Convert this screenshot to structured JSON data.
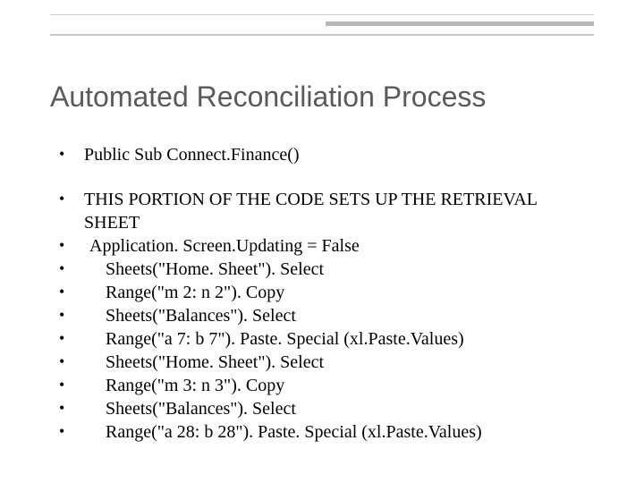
{
  "title": "Automated Reconciliation Process",
  "items": [
    {
      "text": "Public Sub Connect.Finance()",
      "pad": ""
    },
    {
      "text": " THIS PORTION OF THE CODE SETS UP THE RETRIEVAL SHEET",
      "pad": ""
    },
    {
      "text": "Application. Screen.Updating = False",
      "pad": "pad-1"
    },
    {
      "text": "Sheets(\"Home. Sheet\"). Select",
      "pad": "pad-2"
    },
    {
      "text": "Range(\"m 2: n 2\"). Copy",
      "pad": "pad-2"
    },
    {
      "text": "Sheets(\"Balances\"). Select",
      "pad": "pad-2"
    },
    {
      "text": "Range(\"a 7: b 7\"). Paste. Special (xl.Paste.Values)",
      "pad": "pad-2"
    },
    {
      "text": "Sheets(\"Home. Sheet\"). Select",
      "pad": "pad-2"
    },
    {
      "text": "Range(\"m 3: n 3\"). Copy",
      "pad": "pad-2"
    },
    {
      "text": "Sheets(\"Balances\"). Select",
      "pad": "pad-2"
    },
    {
      "text": "Range(\"a 28: b 28\"). Paste. Special (xl.Paste.Values)",
      "pad": "pad-2"
    }
  ]
}
